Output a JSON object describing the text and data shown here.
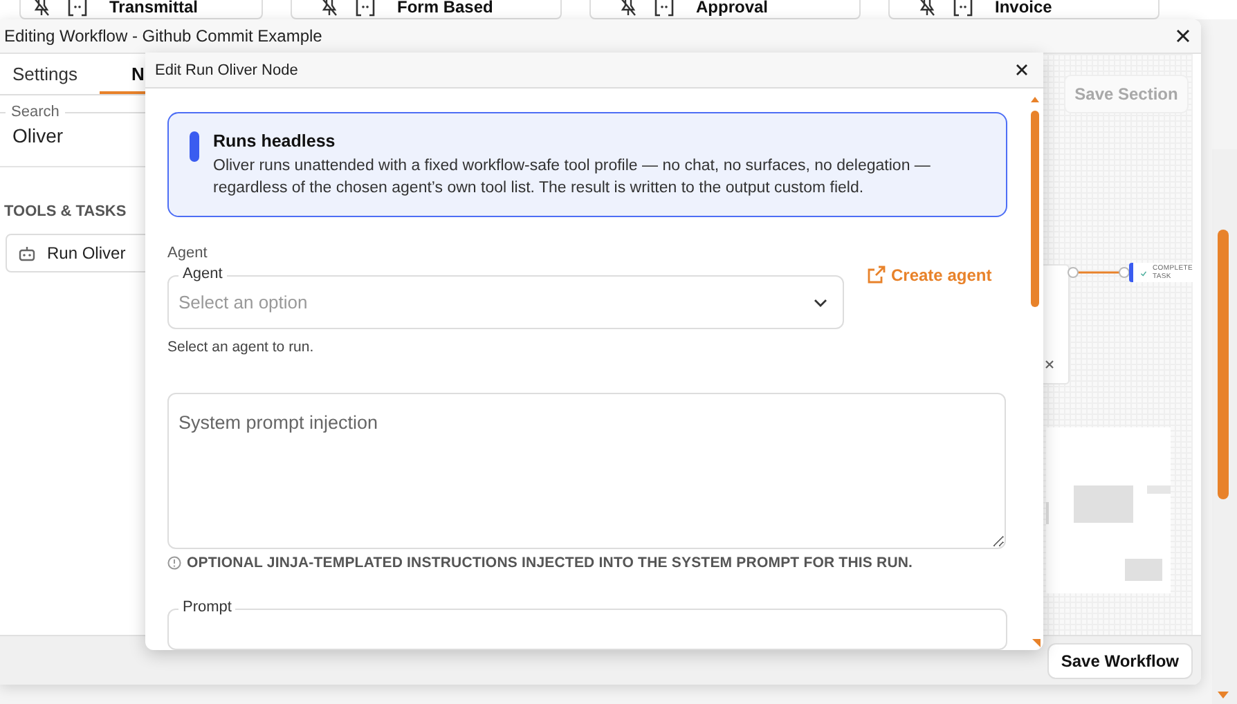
{
  "background_cards": [
    {
      "title": "Transmittal"
    },
    {
      "title": "Form Based"
    },
    {
      "title": "Approval"
    },
    {
      "title": "Invoice"
    }
  ],
  "window": {
    "title": "Editing Workflow - Github Commit Example"
  },
  "tabs": [
    {
      "label": "Settings",
      "selected": false
    },
    {
      "label": "N",
      "selected": true
    }
  ],
  "search": {
    "label": "Search",
    "value": "Oliver"
  },
  "section_header": "TOOLS & TASKS",
  "tools": [
    {
      "label": "Run Oliver"
    }
  ],
  "canvas": {
    "save_section": {
      "label": "Save Section",
      "disabled": true
    },
    "node": {
      "label": "COMPLETE TASK"
    }
  },
  "save_workflow": {
    "label": "Save Workflow"
  },
  "dialog": {
    "title": "Edit Run Oliver Node",
    "notice": {
      "title": "Runs headless",
      "text": "Oliver runs unattended with a fixed workflow-safe tool profile — no chat, no surfaces, no delegation — regardless of the chosen agent’s own tool list. The result is written to the output custom field."
    },
    "agent_section": "Agent",
    "agent_select": {
      "label": "Agent",
      "placeholder": "Select an option"
    },
    "create_agent": "Create agent",
    "agent_help": "Select an agent to run.",
    "system_prompt": {
      "placeholder": "System prompt injection",
      "help": "OPTIONAL JINJA-TEMPLATED INSTRUCTIONS INJECTED INTO THE SYSTEM PROMPT FOR THIS RUN."
    },
    "prompt": {
      "label": "Prompt"
    }
  }
}
